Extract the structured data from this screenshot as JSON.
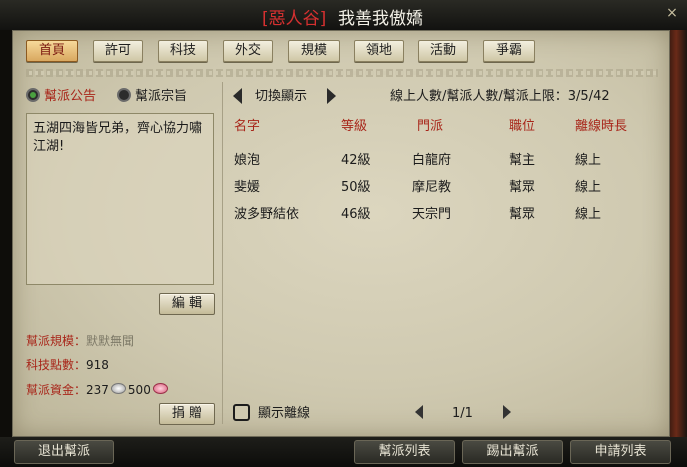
{
  "window": {
    "guild_tag": "[惡人谷]",
    "guild_name": "我善我傲嬌",
    "close_label": "×"
  },
  "tabs": [
    {
      "label": "首頁",
      "active": true
    },
    {
      "label": "許可"
    },
    {
      "label": "科技"
    },
    {
      "label": "外交"
    },
    {
      "label": "規模"
    },
    {
      "label": "領地"
    },
    {
      "label": "活動"
    },
    {
      "label": "爭霸"
    }
  ],
  "left": {
    "radio_announcement": "幫派公告",
    "radio_purpose": "幫派宗旨",
    "notice_text": "五湖四海皆兄弟，齊心協力嘯江湖!",
    "edit_button": "編 輯",
    "scale_label": "幫派規模：",
    "scale_value": "默默無聞",
    "tech_label": "科技點數：",
    "tech_value": "918",
    "funds_label": "幫派資金：",
    "funds_silver": "237",
    "funds_pink": "500",
    "donate_button": "捐 贈"
  },
  "right": {
    "switch_label": "切換顯示",
    "online_label": "線上人數/幫派人數/幫派上限：",
    "online_value": "3/5/42",
    "columns": [
      "名字",
      "等級",
      "門派",
      "職位",
      "離線時長"
    ],
    "members": [
      {
        "name": "娘泡",
        "level": "42級",
        "school": "白龍府",
        "role": "幫主",
        "status": "線上"
      },
      {
        "name": "斐媛",
        "level": "50級",
        "school": "摩尼教",
        "role": "幫眾",
        "status": "線上"
      },
      {
        "name": "波多野結依",
        "level": "46級",
        "school": "天宗門",
        "role": "幫眾",
        "status": "線上"
      }
    ],
    "show_offline_label": "顯示離線",
    "page_indicator": "1/1"
  },
  "bottom": {
    "leave_button": "退出幫派",
    "list_button": "幫派列表",
    "kick_button": "踢出幫派",
    "apply_button": "申請列表"
  },
  "colors": {
    "accent_red": "#a8261a",
    "panel_bg": "#cfc9b0"
  }
}
